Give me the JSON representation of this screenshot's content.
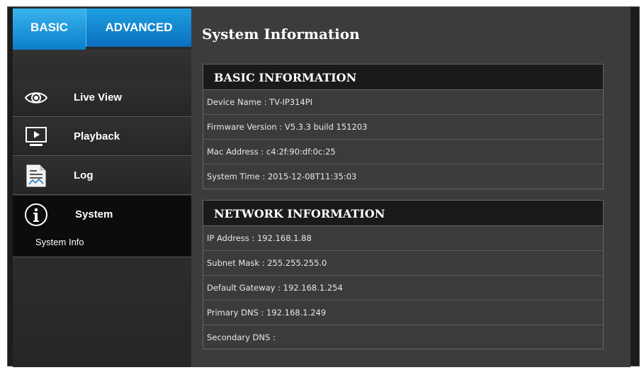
{
  "tabs": {
    "basic": "BASIC",
    "advanced": "ADVANCED"
  },
  "sidebar": {
    "items": [
      {
        "label": "Live View",
        "icon": "eye-icon"
      },
      {
        "label": "Playback",
        "icon": "monitor-play-icon"
      },
      {
        "label": "Log",
        "icon": "document-chart-icon"
      },
      {
        "label": "System",
        "icon": "info-circle-icon"
      }
    ],
    "active": "System",
    "submenu": [
      "System Info"
    ]
  },
  "page_title": "System Information",
  "basic_info": {
    "header": "BASIC INFORMATION",
    "rows": [
      "Device Name : TV-IP314PI",
      "Firmware Version : V5.3.3 build 151203",
      "Mac Address : c4:2f:90:df:0c:25",
      "System Time : 2015-12-08T11:35:03"
    ]
  },
  "network_info": {
    "header": "NETWORK INFORMATION",
    "rows": [
      "IP Address : 192.168.1.88",
      "Subnet Mask : 255.255.255.0",
      "Default Gateway : 192.168.1.254",
      "Primary DNS : 192.168.1.249",
      "Secondary DNS :"
    ]
  },
  "colors": {
    "accent": "#1a96e0",
    "background": "#3c3c3c",
    "sidebar": "#2a2a2a"
  }
}
